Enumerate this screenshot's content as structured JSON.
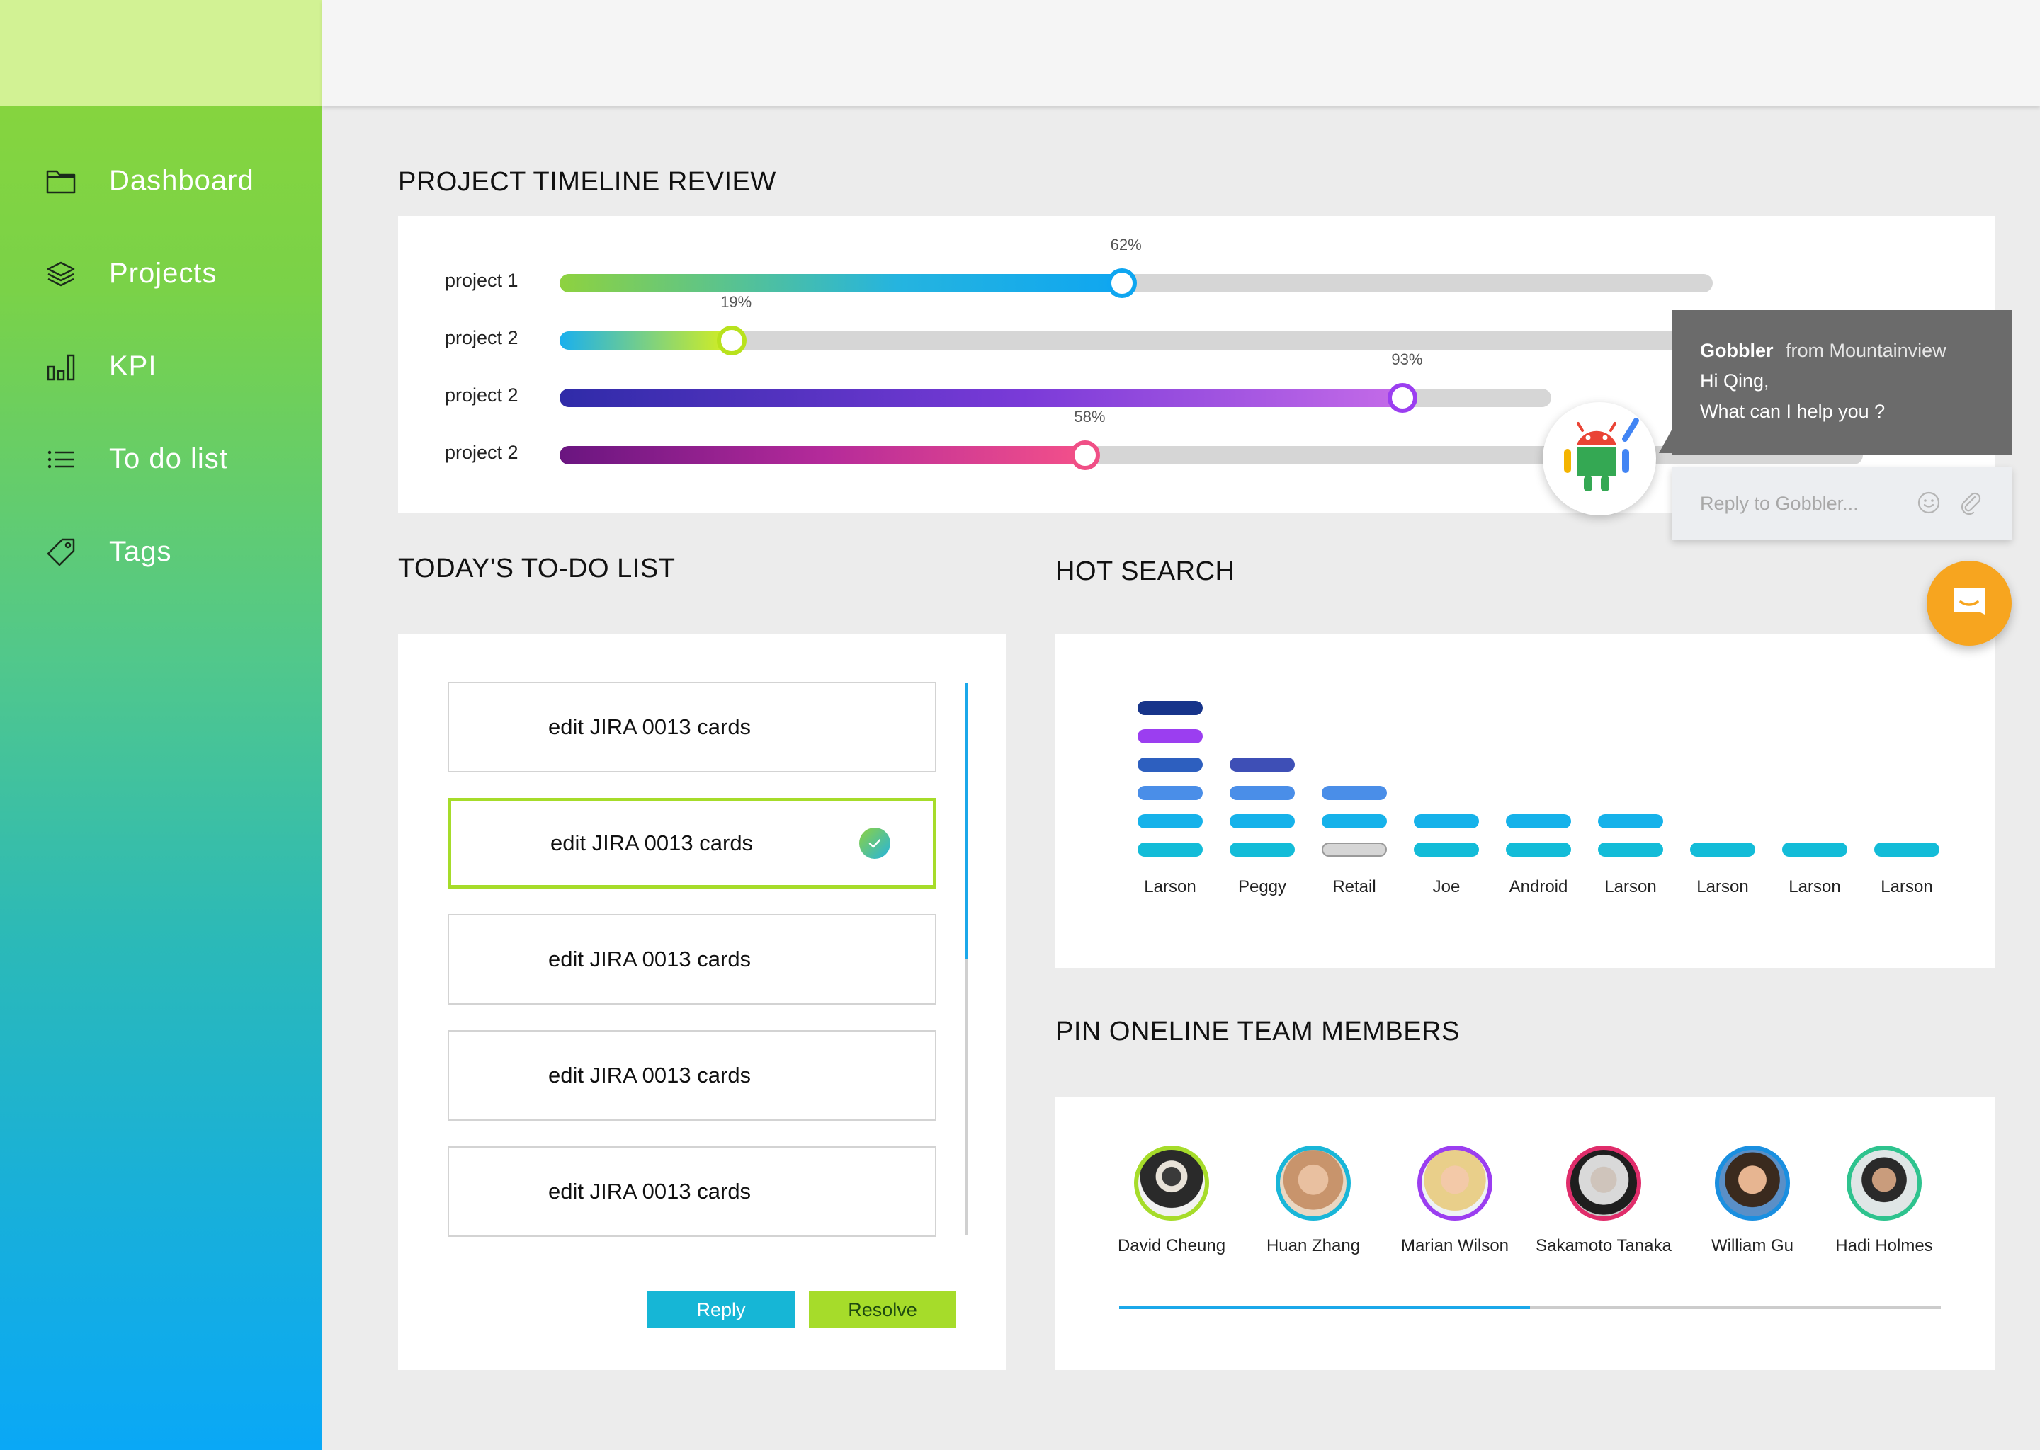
{
  "sidebar": {
    "items": [
      {
        "label": "Dashboard",
        "icon": "folder-icon"
      },
      {
        "label": "Projects",
        "icon": "layers-icon"
      },
      {
        "label": "KPI",
        "icon": "bar-chart-icon"
      },
      {
        "label": "To do list",
        "icon": "list-icon"
      },
      {
        "label": "Tags",
        "icon": "tag-icon"
      }
    ]
  },
  "timeline": {
    "title": "PROJECT TIMELINE REVIEW",
    "projects": [
      {
        "label": "project 1",
        "percent": "62%",
        "value": 0.62
      },
      {
        "label": "project 2",
        "percent": "19%",
        "value": 0.19
      },
      {
        "label": "project 2",
        "percent": "93%",
        "value": 0.93
      },
      {
        "label": "project 2",
        "percent": "58%",
        "value": 0.58
      }
    ]
  },
  "todo": {
    "title": "TODAY'S TO-DO LIST",
    "items": [
      {
        "text": "edit JIRA 0013 cards",
        "done": false
      },
      {
        "text": "edit JIRA 0013 cards",
        "done": true
      },
      {
        "text": "edit JIRA 0013 cards",
        "done": false
      },
      {
        "text": "edit JIRA 0013 cards",
        "done": false
      },
      {
        "text": "edit JIRA 0013 cards",
        "done": false
      }
    ],
    "reply_label": "Reply",
    "resolve_label": "Resolve"
  },
  "hot_search": {
    "title": "HOT SEARCH",
    "columns": [
      {
        "label": "Larson",
        "level": 6
      },
      {
        "label": "Peggy",
        "level": 4
      },
      {
        "label": "Retail",
        "level": 3
      },
      {
        "label": "Joe",
        "level": 2
      },
      {
        "label": "Android",
        "level": 2
      },
      {
        "label": "Larson",
        "level": 2
      },
      {
        "label": "Larson",
        "level": 1
      },
      {
        "label": "Larson",
        "level": 1
      },
      {
        "label": "Larson",
        "level": 1
      }
    ]
  },
  "team": {
    "title": "PIN ONELINE TEAM MEMBERS",
    "members": [
      {
        "name": "David Cheung",
        "ring": "#a6dc2a"
      },
      {
        "name": "Huan Zhang",
        "ring": "#19b6d8"
      },
      {
        "name": "Marian Wilson",
        "ring": "#9b3ef0"
      },
      {
        "name": "Sakamoto Tanaka",
        "ring": "#e02d6b"
      },
      {
        "name": "William Gu",
        "ring": "#1a8fe0"
      },
      {
        "name": "Hadi Holmes",
        "ring": "#2ec38e"
      }
    ],
    "scroll_progress": 0.5
  },
  "chat": {
    "sender": "Gobbler",
    "from_text": "from Mountainview",
    "line1": "Hi Qing,",
    "line2": "What can I help you ?",
    "placeholder": "Reply to Gobbler..."
  },
  "colors": {
    "accent_green": "#a6dc2a",
    "accent_blue": "#19b6d8",
    "launcher": "#f7a51f"
  }
}
